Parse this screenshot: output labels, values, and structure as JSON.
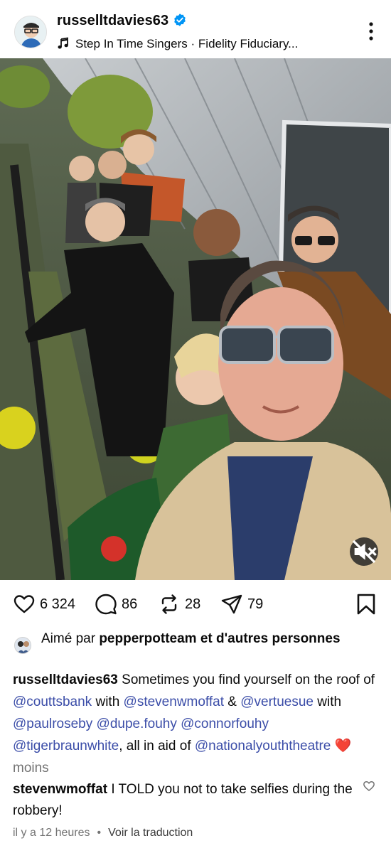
{
  "post_header": {
    "username": "russelltdavies63",
    "music": "Step In Time Singers · Fidelity Fiduciary..."
  },
  "actions": {
    "likes": "6 324",
    "comments": "86",
    "reposts": "28",
    "shares": "79"
  },
  "liked_by": {
    "prefix": "Aimé par",
    "user": "pepperpotteam",
    "suffix": "et d'autres personnes"
  },
  "caption": {
    "author": "russelltdavies63",
    "text_1": "Sometimes you find yourself on the roof of",
    "mention_1": "@couttsbank",
    "text_2": "with",
    "mention_2": "@stevenwmoffat",
    "text_3": "&",
    "mention_3": "@vertuesue",
    "text_4": "with",
    "mention_4": "@paulroseby",
    "mention_5": "@dupe.fouhy",
    "mention_6": "@connorfouhy",
    "mention_7": "@tigerbraunwhite",
    "text_5": ", all in aid of",
    "mention_8": "@nationalyouththeatre",
    "emoji": "❤️",
    "less_label": "moins"
  },
  "comment": {
    "author": "stevenwmoffat",
    "text": "I TOLD you not to take selfies during the robbery!"
  },
  "footer": {
    "time": "il y a 12 heures",
    "separator": "•",
    "translate_label": "Voir la traduction"
  },
  "icons": {
    "verified": "verified-badge-icon",
    "music": "music-note-icon",
    "more": "more-vertical-icon",
    "mute": "speaker-muted-icon",
    "like": "heart-icon",
    "comment": "comment-bubble-icon",
    "repost": "repost-icon",
    "share": "send-icon",
    "save": "bookmark-icon"
  },
  "colors": {
    "verified": "#0095f6",
    "mention": "#3b4da8",
    "muted_text": "#737373",
    "heart": "#ed1f47"
  }
}
